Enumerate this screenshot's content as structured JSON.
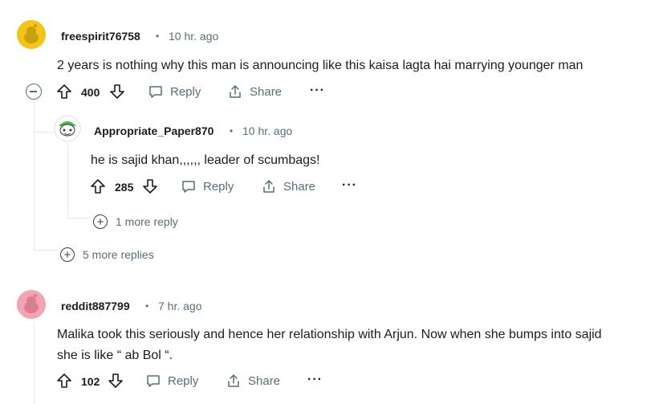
{
  "comments": [
    {
      "username": "freespirit76758",
      "separator": "•",
      "time": "10 hr. ago",
      "text": "2 years is nothing why this man is announcing like this kaisa lagta hai marrying younger man",
      "votes": "400",
      "reply_label": "Reply",
      "share_label": "Share",
      "more_label": "···",
      "avatar_color": "#f2c31a"
    },
    {
      "username": "Appropriate_Paper870",
      "separator": "•",
      "time": "10 hr. ago",
      "text": "he is sajid khan,,,,,, leader of scumbags!",
      "votes": "285",
      "reply_label": "Reply",
      "share_label": "Share",
      "more_label": "···",
      "avatar_color": "#46b94a",
      "more_replies": "1 more reply"
    },
    {
      "username": "reddit887799",
      "separator": "•",
      "time": "7 hr. ago",
      "text_line1": "Malika took this seriously and hence her relationship with Arjun. Now when she bumps into sajid",
      "text_line2": "she is like “ ab Bol “.",
      "votes": "102",
      "reply_label": "Reply",
      "share_label": "Share",
      "more_label": "···",
      "avatar_color": "#f4a3b4"
    }
  ],
  "thread_more_replies": "5 more replies",
  "expand_symbol": "+"
}
